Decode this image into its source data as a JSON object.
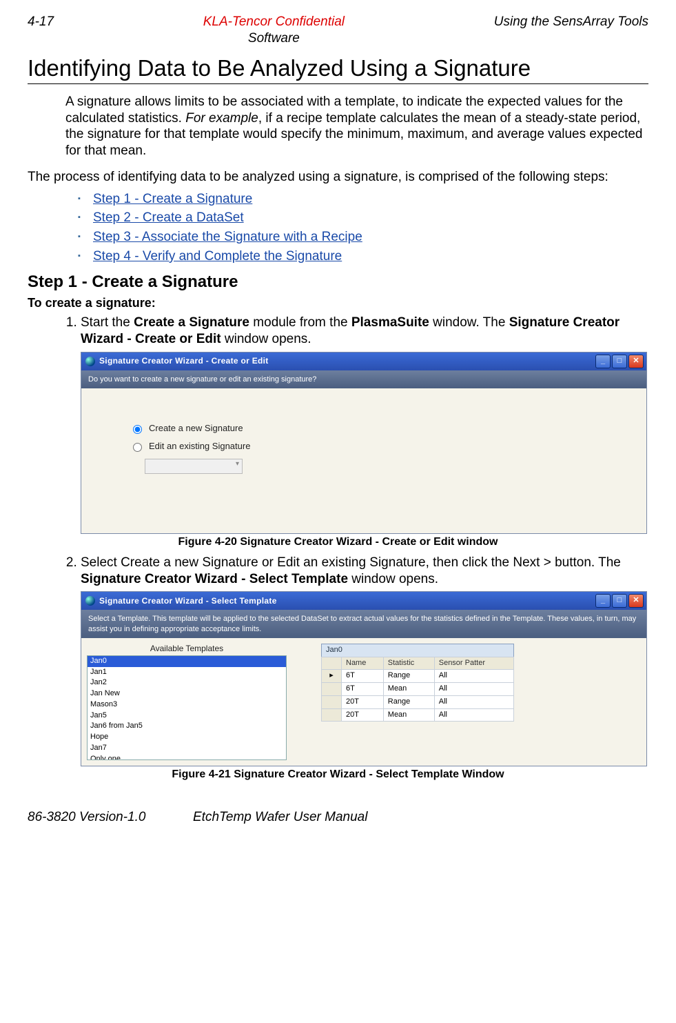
{
  "header": {
    "page_num": "4-17",
    "confidential": "KLA-Tencor Confidential",
    "software": "Software",
    "section": "Using the SensArray Tools"
  },
  "title": "Identifying Data to Be Analyzed Using a Signature",
  "intro1_a": "A signature allows limits to be associated with a template, to indicate the expected values for the calculated statistics. ",
  "intro1_i": "For example",
  "intro1_b": ", if a recipe template calculates the mean of a steady-state period, the signature for that template would specify the minimum, maximum, and average values expected for that mean.",
  "intro2": "The process of identifying data to be analyzed using a signature, is comprised of the following steps:",
  "steps": [
    "Step 1 - Create a Signature",
    "Step 2 - Create a DataSet",
    "Step 3 - Associate the Signature with a Recipe",
    "Step 4 - Verify and Complete the Signature"
  ],
  "step1_heading": "Step 1 - Create a Signature",
  "step1_sub": "To create a signature:",
  "proc1_a": "Start the ",
  "proc1_b1": "Create a Signature",
  "proc1_c": " module from the ",
  "proc1_b2": "PlasmaSuite",
  "proc1_d": " window. The ",
  "proc1_b3": "Signature Creator Wizard - Create or Edit",
  "proc1_e": " window opens.",
  "win1": {
    "title": "Signature Creator Wizard - Create or Edit",
    "info": "Do you want to create a new signature or edit an existing signature?",
    "opt1": "Create a new Signature",
    "opt2": "Edit an existing Signature"
  },
  "caption1": "Figure 4-20 Signature Creator Wizard - Create or Edit window",
  "proc2_a": "Select Create a new Signature or Edit an existing Signature, then click the Next > button. The ",
  "proc2_b": "Signature Creator Wizard - Select Template",
  "proc2_c": " window opens.",
  "win2": {
    "title": "Signature Creator Wizard - Select Template",
    "info": "Select a Template. This template will be applied to the selected DataSet to extract actual values for the statistics defined in the Template. These values, in turn, may assist you in defining appropriate acceptance limits.",
    "templates_label": "Available Templates",
    "templates": [
      "Jan0",
      "Jan1",
      "Jan2",
      "Jan New",
      "Mason3",
      "Jan5",
      "Jan6 from Jan5",
      "Hope",
      "Jan7",
      "Only one"
    ],
    "grid_title": "Jan0",
    "columns": [
      "",
      "Name",
      "Statistic",
      "Sensor Patter"
    ],
    "rows": [
      {
        "marker": "▸",
        "name": "6T",
        "stat": "Range",
        "sensor": "All"
      },
      {
        "marker": "",
        "name": "6T",
        "stat": "Mean",
        "sensor": "All"
      },
      {
        "marker": "",
        "name": "20T",
        "stat": "Range",
        "sensor": "All"
      },
      {
        "marker": "",
        "name": "20T",
        "stat": "Mean",
        "sensor": "All"
      }
    ]
  },
  "caption2": "Figure 4-21 Signature Creator Wizard - Select Template Window",
  "footer": {
    "doc_id": "86-3820 Version-1.0",
    "manual": "EtchTemp Wafer User Manual"
  }
}
